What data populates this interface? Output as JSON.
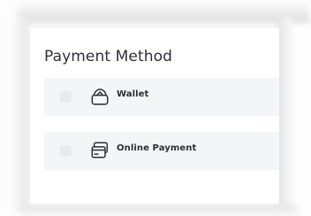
{
  "payment": {
    "title": "Payment Method",
    "options": [
      {
        "label": "Wallet",
        "icon": "wallet-icon",
        "checked": false
      },
      {
        "label": "Online Payment",
        "icon": "credit-card-icon",
        "checked": false
      }
    ]
  },
  "colors": {
    "background": "#ffffff",
    "row_background": "#f4f5f7",
    "checkbox": "#e9eaed",
    "text": "#2f2f3a"
  }
}
